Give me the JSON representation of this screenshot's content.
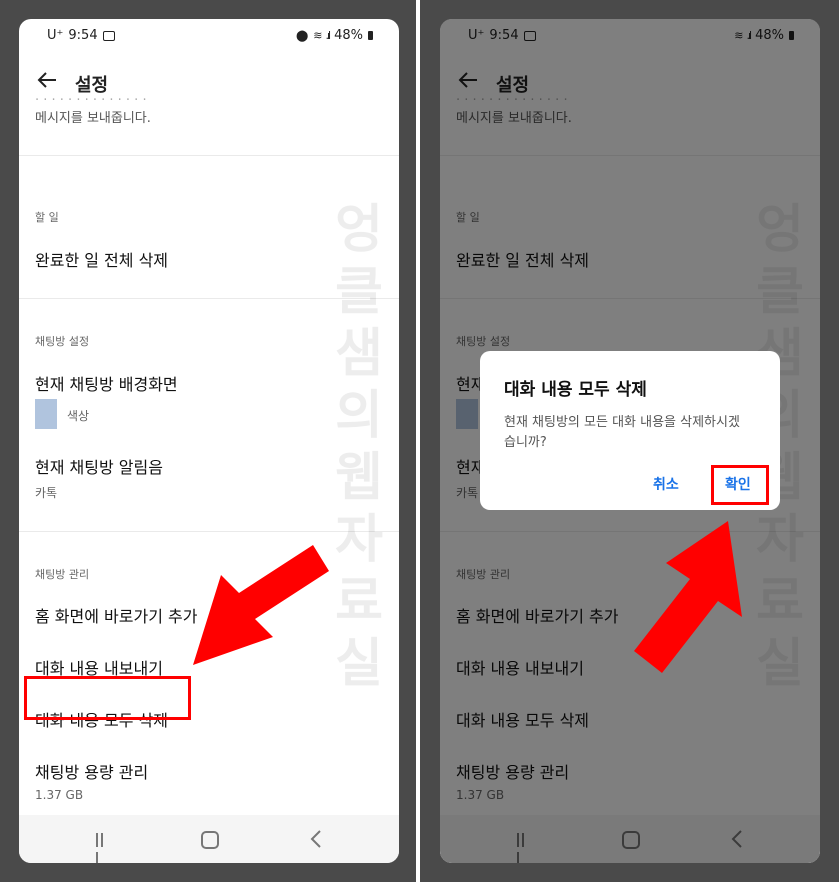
{
  "status": {
    "carrier": "U⁺",
    "time": "9:54",
    "battery": "48%"
  },
  "app_bar": {
    "title": "설정"
  },
  "settings": {
    "intro_text": "메시지를 보내줍니다.",
    "todo_header": "할 일",
    "todo_delete_all": "완료한 일 전체 삭제",
    "chatroom_settings_header": "채팅방 설정",
    "background_title": "현재 채팅방 배경화면",
    "background_sub": "색상",
    "notification_title": "현재 채팅방 알림음",
    "notification_sub": "카톡",
    "chatroom_manage_header": "채팅방 관리",
    "add_shortcut": "홈 화면에 바로가기 추가",
    "export_chat": "대화 내용 내보내기",
    "delete_all_chat": "대화 내용 모두 삭제",
    "storage_title": "채팅방 용량 관리",
    "storage_sub": "1.37 GB"
  },
  "dialog": {
    "title": "대화 내용 모두 삭제",
    "body": "현재 채팅방의 모든 대화 내용을 삭제하시겠습니까?",
    "cancel": "취소",
    "confirm": "확인"
  },
  "watermark": "엉클샘의웹자료실",
  "colors": {
    "highlight": "#ff0000",
    "accent": "#1a73e8",
    "swatch": "#b0c4de"
  }
}
